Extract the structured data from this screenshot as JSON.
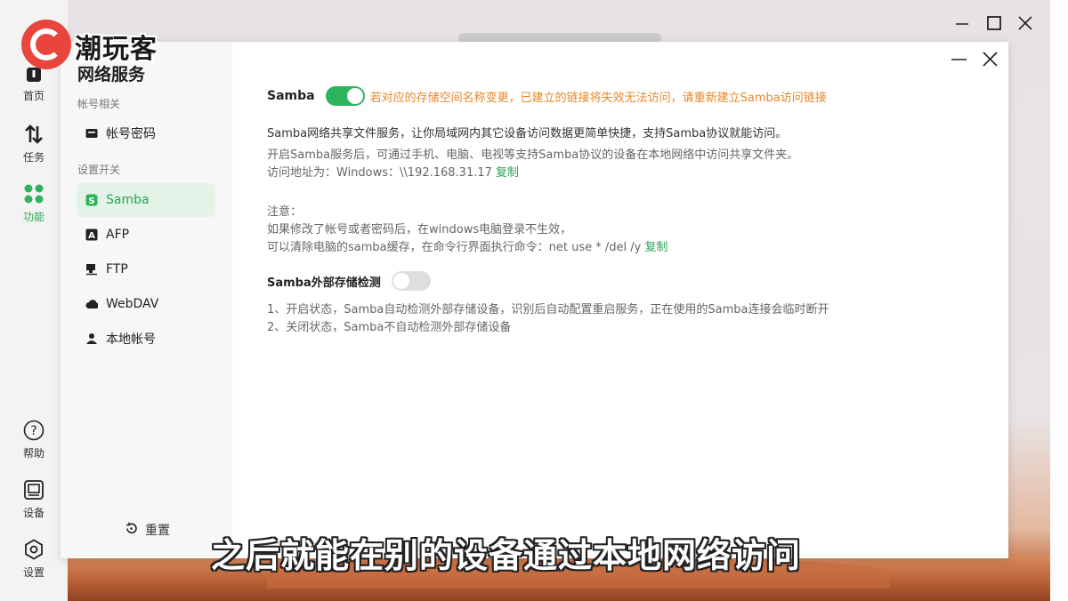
{
  "brand": "潮玩客",
  "rail": {
    "items": [
      {
        "label": "首页",
        "icon": "home-icon"
      },
      {
        "label": "任务",
        "icon": "transfer-icon"
      },
      {
        "label": "功能",
        "icon": "apps-icon",
        "active": true
      },
      {
        "label": "帮助",
        "icon": "help-icon"
      },
      {
        "label": "设备",
        "icon": "device-icon"
      },
      {
        "label": "设置",
        "icon": "settings-icon"
      }
    ]
  },
  "sidebar": {
    "title": "网络服务",
    "section_account": "帐号相关",
    "account_item": "帐号密码",
    "section_switch": "设置开关",
    "items": [
      {
        "label": "Samba",
        "icon": "samba-icon"
      },
      {
        "label": "AFP",
        "icon": "afp-icon"
      },
      {
        "label": "FTP",
        "icon": "ftp-icon"
      },
      {
        "label": "WebDAV",
        "icon": "cloud-icon"
      },
      {
        "label": "本地帐号",
        "icon": "user-icon"
      }
    ],
    "reset_label": "重置"
  },
  "main": {
    "samba_label": "Samba",
    "samba_enabled": true,
    "samba_warning": "若对应的存储空间名称变更，已建立的链接将失效无法访问，请重新建立Samba访问链接",
    "desc1": "Samba网络共享文件服务，让你局域网内其它设备访问数据更简单快捷，支持Samba协议就能访问。",
    "desc2": "开启Samba服务后，可通过手机、电脑、电视等支持Samba协议的设备在本地网络中访问共享文件夹。",
    "address_prefix": "访问地址为：Windows：\\\\192.168.31.17",
    "copy_label": "复制",
    "note_title": "注意：",
    "note1": "如果修改了帐号或者密码后，在windows电脑登录不生效，",
    "note2": "可以清除电脑的samba缓存，在命令行界面执行命令：net use * /del /y",
    "copy_label2": "复制",
    "external_label": "Samba外部存储检测",
    "external_enabled": false,
    "ext_desc1": "1、开启状态，Samba自动检测外部存储设备，识别后自动配置重启服务，正在使用的Samba连接会临时断开",
    "ext_desc2": "2、关闭状态，Samba不自动检测外部存储设备"
  },
  "subtitle": "之后就能在别的设备通过本地网络访问",
  "colors": {
    "accent": "#2fb35c",
    "warning": "#e8862a",
    "logo": "#e8453c"
  }
}
